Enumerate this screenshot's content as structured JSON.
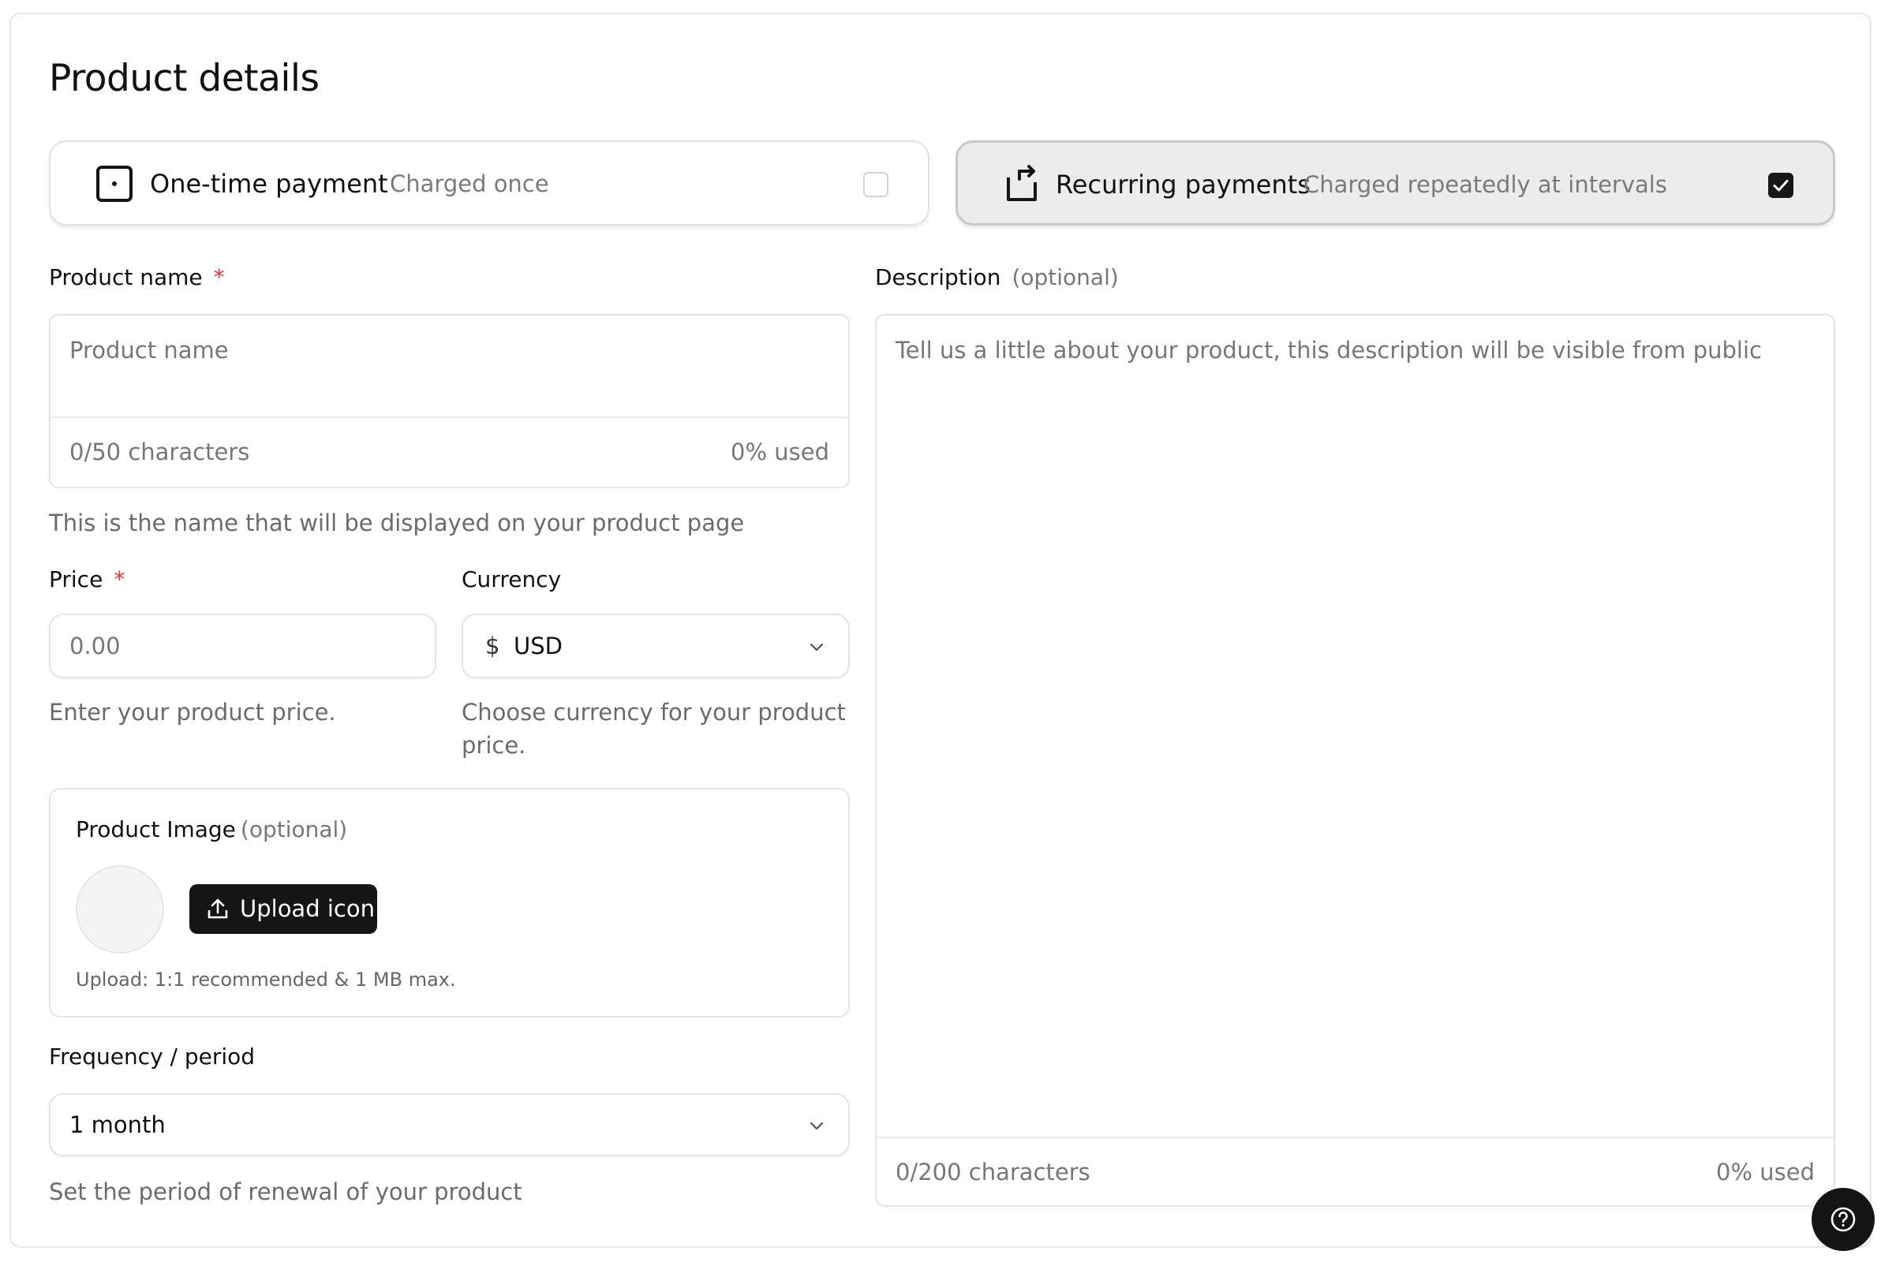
{
  "page": {
    "title": "Product details"
  },
  "payment_types": [
    {
      "title": "One-time payment",
      "subtitle": "Charged once",
      "icon": "square-dot-icon",
      "checked": false
    },
    {
      "title": "Recurring payments",
      "subtitle": "Charged repeatedly at intervals",
      "icon": "repeat-icon",
      "checked": true
    }
  ],
  "product_name": {
    "label": "Product name",
    "required_mark": "*",
    "placeholder": "Product name",
    "counter": "0/50 characters",
    "usage": "0% used",
    "help": "This is the name that will be displayed on your product page"
  },
  "price": {
    "label": "Price",
    "required_mark": "*",
    "placeholder": "0.00",
    "help": "Enter your product price."
  },
  "currency": {
    "label": "Currency",
    "symbol": "$",
    "value": "USD",
    "help": "Choose currency for your product price."
  },
  "product_image": {
    "label": "Product Image",
    "optional": "(optional)",
    "upload_label": "Upload icon",
    "hint": "Upload: 1:1 recommended & 1 MB max."
  },
  "frequency": {
    "label": "Frequency / period",
    "value": "1 month",
    "help": "Set the period of renewal of your product"
  },
  "description": {
    "label": "Description",
    "optional": "(optional)",
    "placeholder": "Tell us a little about your product, this description will be visible from public",
    "counter": "0/200 characters",
    "usage": "0% used"
  },
  "colors": {
    "accent": "#171717",
    "required": "#e03535",
    "muted": "#777777"
  }
}
